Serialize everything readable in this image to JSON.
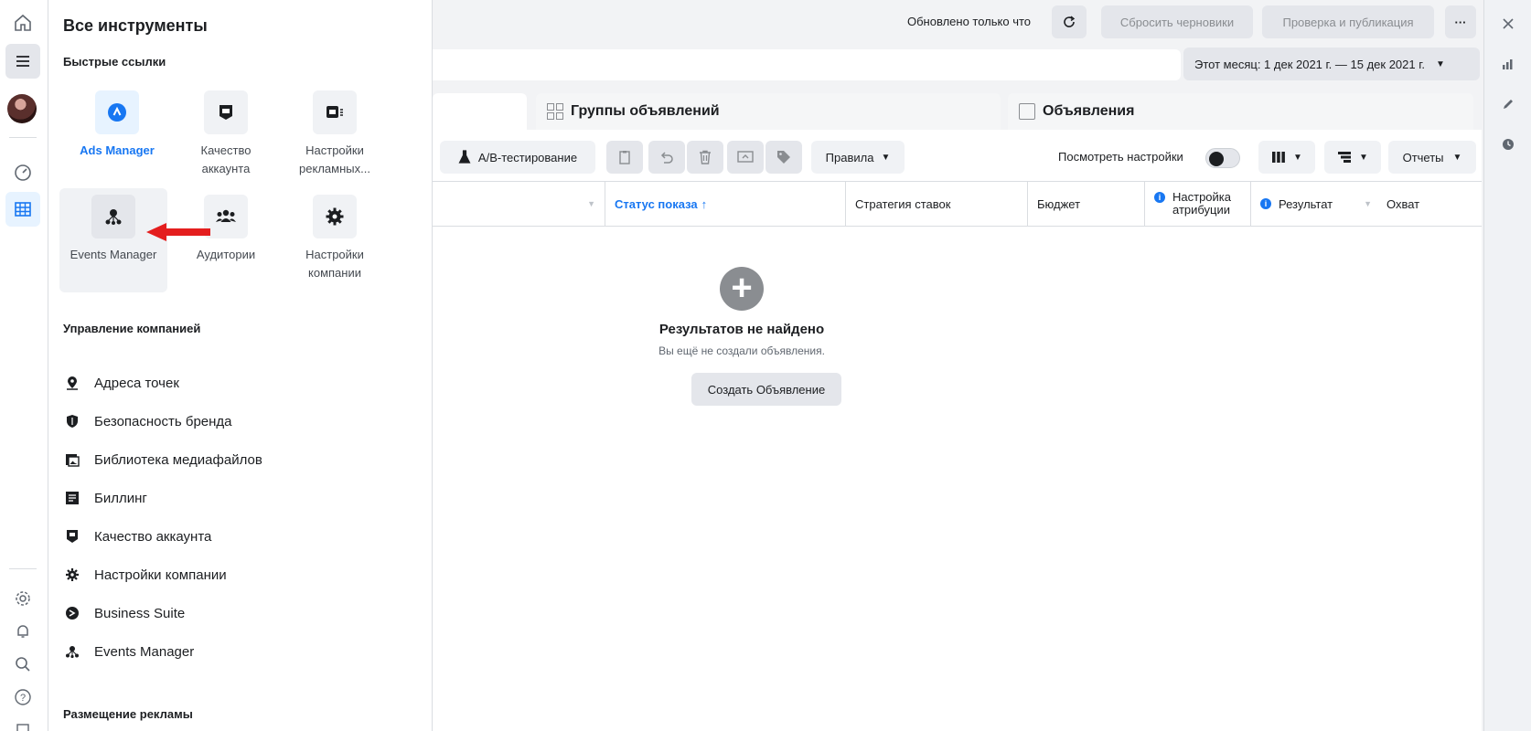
{
  "panel": {
    "title": "Все инструменты",
    "quick_links_heading": "Быстрые ссылки",
    "quick_links": [
      {
        "label": "Ads Manager",
        "icon": "ads-manager-icon",
        "active": true
      },
      {
        "label": "Качество аккаунта",
        "icon": "account-quality-icon"
      },
      {
        "label": "Настройки рекламных...",
        "icon": "ad-settings-icon"
      },
      {
        "label": "Events Manager",
        "icon": "events-manager-icon",
        "highlighted": true
      },
      {
        "label": "Аудитории",
        "icon": "audiences-icon"
      },
      {
        "label": "Настройки компании",
        "icon": "company-settings-icon"
      }
    ],
    "manage_heading": "Управление компанией",
    "manage_items": [
      {
        "label": "Адреса точек",
        "icon": "location-icon"
      },
      {
        "label": "Безопасность бренда",
        "icon": "shield-icon"
      },
      {
        "label": "Библиотека медиафайлов",
        "icon": "media-library-icon"
      },
      {
        "label": "Биллинг",
        "icon": "billing-icon"
      },
      {
        "label": "Качество аккаунта",
        "icon": "account-quality-icon"
      },
      {
        "label": "Настройки компании",
        "icon": "gear-icon"
      },
      {
        "label": "Business Suite",
        "icon": "business-suite-icon"
      },
      {
        "label": "Events Manager",
        "icon": "events-manager-icon"
      }
    ],
    "placement_heading": "Размещение рекламы"
  },
  "topbar": {
    "updated_text": "Обновлено только что",
    "reset_label": "Сбросить черновики",
    "publish_label": "Проверка и публикация",
    "more_label": "···"
  },
  "date_range": "Этот месяц: 1 дек 2021 г. — 15 дек 2021 г.",
  "tabs": {
    "ad_sets": "Группы объявлений",
    "ads": "Объявления"
  },
  "toolbar": {
    "ab_test": "A/B-тестирование",
    "rules": "Правила",
    "view_settings": "Посмотреть настройки",
    "reports": "Отчеты"
  },
  "columns": {
    "delivery_status": "Статус показа",
    "bid_strategy": "Стратегия ставок",
    "budget": "Бюджет",
    "attribution_line1": "Настройка",
    "attribution_line2": "атрибуции",
    "results": "Результат",
    "reach": "Охват"
  },
  "empty_state": {
    "title": "Результатов не найдено",
    "subtitle": "Вы ещё не создали объявления.",
    "button": "Создать Объявление"
  },
  "colors": {
    "accent": "#1877f2",
    "arrow": "#e41e1e"
  }
}
